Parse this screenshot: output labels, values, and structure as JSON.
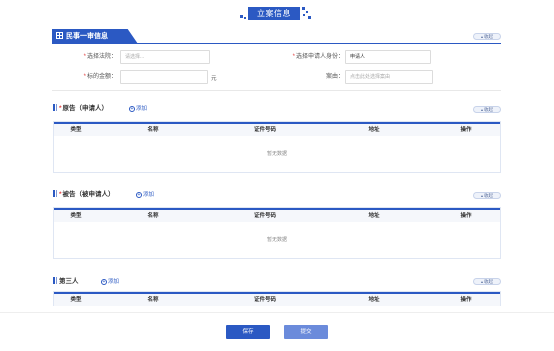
{
  "page_title": "立案信息",
  "basic": {
    "tab_label": "民事一审信息",
    "collapse_label": "收起",
    "court_label": "选择法院：",
    "court_placeholder": "请选择...",
    "identity_label": "选择申请人身份：",
    "identity_value": "申请人",
    "amount_label": "标的金额：",
    "amount_unit": "元",
    "cause_label": "案由：",
    "cause_placeholder": "点击此处选择案由"
  },
  "plaintiff": {
    "title": "原告（申请人）",
    "add_label": "添加",
    "collapse_label": "收起",
    "columns": [
      "类型",
      "名称",
      "证件号码",
      "地址",
      "操作"
    ],
    "empty_text": "暂无数据"
  },
  "defendant": {
    "title": "被告（被申请人）",
    "add_label": "添加",
    "collapse_label": "收起",
    "columns": [
      "类型",
      "名称",
      "证件号码",
      "地址",
      "操作"
    ],
    "empty_text": "暂无数据"
  },
  "third_party": {
    "title": "第三人",
    "add_label": "添加",
    "collapse_label": "收起",
    "columns": [
      "类型",
      "名称",
      "证件号码",
      "地址",
      "操作"
    ]
  },
  "footer": {
    "save_label": "保存",
    "submit_label": "提交"
  },
  "colors": {
    "primary": "#2b59c3",
    "submit": "#6b8bdb",
    "required": "#e23b3b"
  }
}
